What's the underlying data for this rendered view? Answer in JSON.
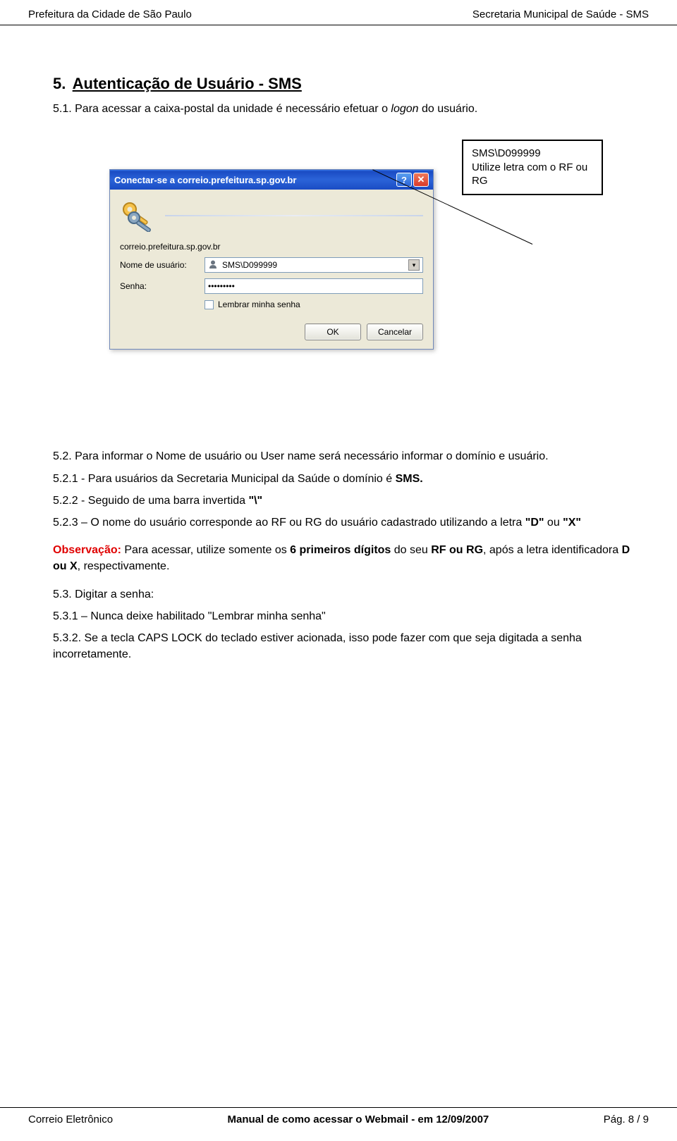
{
  "header": {
    "left": "Prefeitura da Cidade de São Paulo",
    "right": "Secretaria Municipal de Saúde - SMS"
  },
  "section": {
    "number": "5.",
    "title": "Autenticação de Usuário - SMS",
    "p51_prefix": "5.1. Para acessar a caixa-postal da unidade é necessário efetuar o ",
    "p51_italic": "logon",
    "p51_suffix": " do usuário."
  },
  "callout": {
    "line1": "SMS\\D099999",
    "line2": "Utilize letra com o RF ou RG"
  },
  "dialog": {
    "title": "Conectar-se a correio.prefeitura.sp.gov.br",
    "server": "correio.prefeitura.sp.gov.br",
    "label_user": "Nome de usuário:",
    "label_pass": "Senha:",
    "user_value": "SMS\\D099999",
    "pass_value": "•••••••••",
    "remember": "Lembrar minha senha",
    "ok": "OK",
    "cancel": "Cancelar"
  },
  "body": {
    "p52": "5.2. Para informar o Nome de usuário ou User name será necessário informar o domínio e usuário.",
    "p521_prefix": "5.2.1 - Para usuários da Secretaria Municipal da Saúde o domínio é ",
    "p521_bold": "SMS.",
    "p522_prefix": "5.2.2 - Seguido de uma barra invertida ",
    "p522_bold": "\"\\\"",
    "p523_prefix": "5.2.3 – O nome do usuário corresponde ao RF ou RG do usuário cadastrado utilizando a letra ",
    "p523_bold1": "\"D\"",
    "p523_mid": " ou ",
    "p523_bold2": "\"X\"",
    "obs_label": "Observação:",
    "obs_text1": " Para acessar, utilize somente os ",
    "obs_bold1": "6 primeiros dígitos",
    "obs_text2": " do seu ",
    "obs_bold2": "RF ou RG",
    "obs_text3": ", após a letra identificadora ",
    "obs_bold3": "D ou X",
    "obs_text4": ", respectivamente.",
    "p53": "5.3. Digitar a senha:",
    "p531": "5.3.1 – Nunca deixe habilitado \"Lembrar minha senha\"",
    "p532": "5.3.2. Se a tecla CAPS LOCK do teclado estiver acionada, isso pode fazer com que seja digitada a senha incorretamente."
  },
  "footer": {
    "left": "Correio Eletrônico",
    "center": "Manual de como acessar o Webmail -  em 12/09/2007",
    "right": "Pág. 8 / 9"
  }
}
